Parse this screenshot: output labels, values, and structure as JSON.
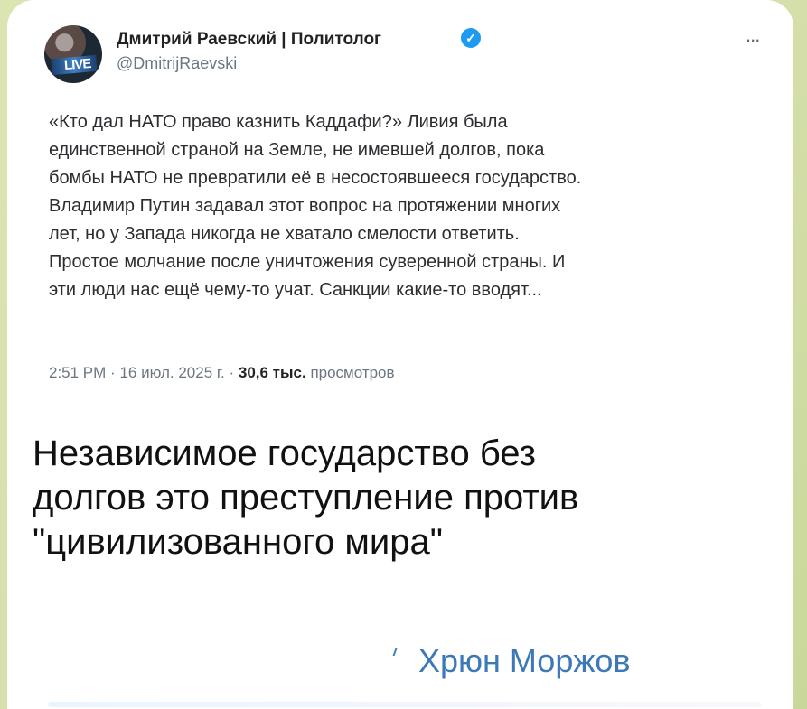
{
  "post": {
    "author": {
      "name": "Дмитрий Раевский | Политолог",
      "handle": "@DmitrijRaevski",
      "avatar_text": "LIVE"
    },
    "text_lines": [
      "«Кто дал НАТО право казнить Каддафи?» Ливия была",
      "единственной страной на Земле, не имевшей долгов, пока",
      "бомбы НАТО не превратили её в несостоявшееся государство.",
      "Владимир Путин задавал этот вопрос на протяжении многих",
      "лет, но у Запада никогда не хватало смелости ответить.",
      "Простое молчание после уничтожения суверенной страны. И",
      "эти люди нас ещё чему-то учат. Санкции какие-то вводят..."
    ],
    "time": "2:51 PM",
    "separator_1": "·",
    "date": "16 июл. 2025 г.",
    "separator_2": "·",
    "views_count": "30,6 тыс.",
    "views_label": "просмотров",
    "more_icon": "..."
  },
  "caption": {
    "lines": [
      "Независимое государство без",
      "долгов это преступление против",
      "\"цивилизованного мира\""
    ]
  },
  "signature": {
    "text": "Хрюн Моржов"
  },
  "icons": {
    "verified_badge": "verified-badge-icon",
    "more": "more-horizontal-icon"
  },
  "colors": {
    "background": "#d6e0ac",
    "accent": "#3d79b7",
    "verified": "#1d9bf0",
    "muted_text": "#6b7680"
  }
}
